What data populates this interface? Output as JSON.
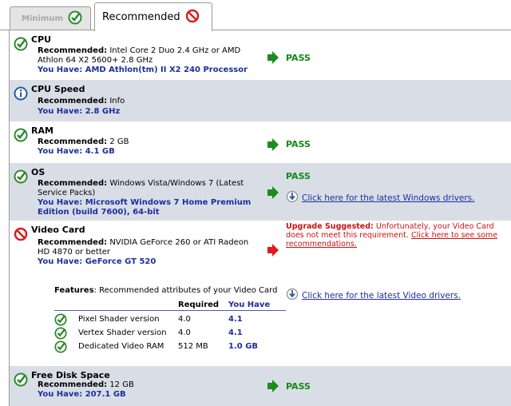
{
  "tabs": [
    {
      "label": "Minimum",
      "status": "pass"
    },
    {
      "label": "Recommended",
      "status": "fail"
    }
  ],
  "labels": {
    "recommended": "Recommended:",
    "you_have": "You Have:",
    "pass": "PASS",
    "upgrade_suggested": "Upgrade Suggested:",
    "windows_drivers": "Click here for the latest Windows drivers.",
    "video_drivers": "Click here for the latest Video drivers."
  },
  "rows": {
    "cpu": {
      "name": "CPU",
      "recommended": "Intel Core 2 Duo 2.4 GHz or AMD Athlon 64 X2 5600+ 2.8 GHz",
      "you_have": "AMD Athlon(tm) II X2 240 Processor"
    },
    "cpu_speed": {
      "name": "CPU Speed",
      "recommended": "Info",
      "you_have": "2.8 GHz"
    },
    "ram": {
      "name": "RAM",
      "recommended": "2 GB",
      "you_have": "4.1 GB"
    },
    "os": {
      "name": "OS",
      "recommended": "Windows Vista/Windows 7 (Latest Service Packs)",
      "you_have": "Microsoft Windows 7 Home Premium Edition (build 7600), 64-bit"
    },
    "video": {
      "name": "Video Card",
      "recommended": "NVIDIA GeForce 260 or ATI Radeon HD 4870 or better",
      "you_have": "GeForce GT 520",
      "upgrade_text": "Unfortunately, your Video Card does not meet this requirement.",
      "upgrade_link": "Click here to see some recommendations."
    },
    "disk": {
      "name": "Free Disk Space",
      "recommended": "12 GB",
      "you_have": "207.1 GB"
    }
  },
  "features": {
    "title_bold": "Features",
    "title_rest": ": Recommended attributes of your Video Card",
    "col_required": "Required",
    "col_you_have": "You Have",
    "items": [
      {
        "attr": "Pixel Shader version",
        "required": "4.0",
        "have": "4.1"
      },
      {
        "attr": "Vertex Shader version",
        "required": "4.0",
        "have": "4.1"
      },
      {
        "attr": "Dedicated Video RAM",
        "required": "512 MB",
        "have": "1.0 GB"
      }
    ]
  },
  "colors": {
    "pass": "#148a14",
    "fail": "#cc1111",
    "link": "#1b2fa0",
    "shade": "#d9dee6"
  }
}
